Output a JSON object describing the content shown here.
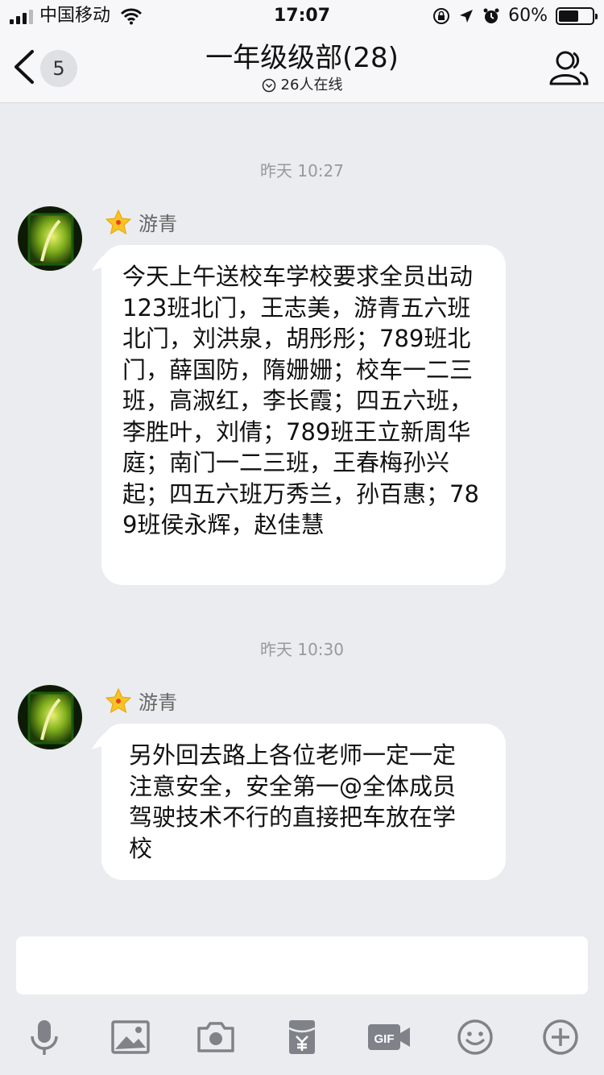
{
  "status_bar": {
    "carrier": "中国移动",
    "time": "17:07",
    "battery_percent": "60%",
    "battery_level": 0.6
  },
  "header": {
    "back_count": "5",
    "title": "一年级级部(28)",
    "online": "26人在线"
  },
  "messages": [
    {
      "timestamp": "昨天 10:27",
      "sender": "游青",
      "text": "今天上午送校车学校要求全员出动123班北门，王志美，游青五六班北门，刘洪泉，胡彤彤；789班北门，薛国防，隋姗姗；校车一二三班，高淑红，李长霞；四五六班，李胜叶，刘倩；789班王立新周华庭；南门一二三班，王春梅孙兴起；四五六班万秀兰，孙百惠；789班侯永辉，赵佳慧"
    },
    {
      "timestamp": "昨天 10:30",
      "sender": "游青",
      "text": "另外回去路上各位老师一定一定注意安全，安全第一@全体成员 驾驶技术不行的直接把车放在学校"
    }
  ],
  "input": {
    "placeholder": ""
  },
  "toolbar_icons": [
    "microphone-icon",
    "image-icon",
    "camera-icon",
    "red-packet-icon",
    "gif-icon",
    "emoji-icon",
    "plus-icon"
  ]
}
